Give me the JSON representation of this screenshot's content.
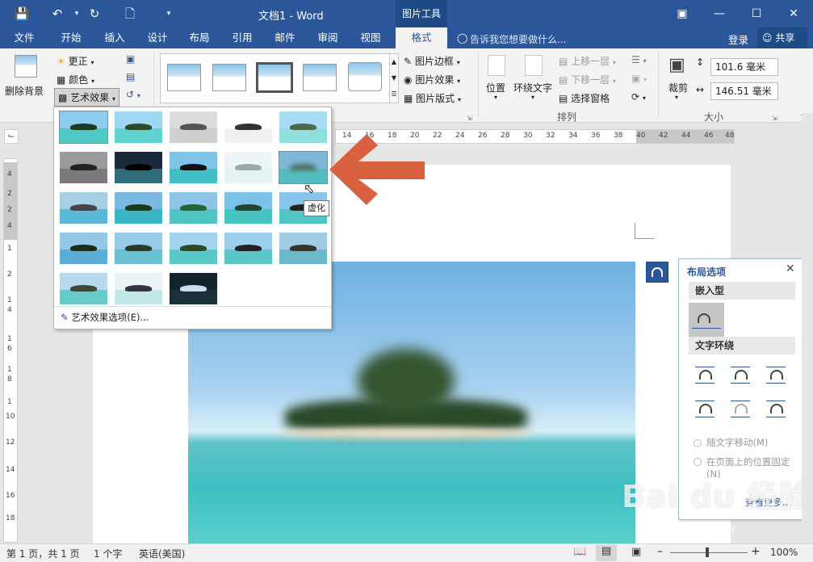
{
  "title": {
    "doc_title": "文档1 - Word",
    "context_tab_group": "图片工具"
  },
  "icons": {
    "save": "save-icon",
    "undo": "undo-icon",
    "redo": "redo-icon",
    "new": "new-doc-icon",
    "customize": "customize-qat-icon"
  },
  "tabs": [
    {
      "label": "文件"
    },
    {
      "label": "开始"
    },
    {
      "label": "插入"
    },
    {
      "label": "设计"
    },
    {
      "label": "布局"
    },
    {
      "label": "引用"
    },
    {
      "label": "邮件"
    },
    {
      "label": "审阅"
    },
    {
      "label": "视图"
    },
    {
      "label": "格式"
    }
  ],
  "tell_me": "告诉我您想要做什么...",
  "sign_in": "登录",
  "share": "共享",
  "ribbon": {
    "remove_bg": "删除背景",
    "corrections": "更正",
    "color": "颜色",
    "artistic": "艺术效果",
    "picture_border": "图片边框",
    "picture_effects": "图片效果",
    "picture_layout": "图片版式",
    "position": "位置",
    "wrap_text": "环绕文字",
    "bring_forward": "上移一层",
    "send_backward": "下移一层",
    "selection_pane": "选择窗格",
    "arrange_group": "排列",
    "crop": "裁剪",
    "height": "101.6 毫米",
    "width": "146.51 毫米",
    "size_group": "大小"
  },
  "ruler_numbers": [
    "14",
    "16",
    "18",
    "20",
    "22",
    "24",
    "26",
    "28",
    "30",
    "32",
    "34",
    "36",
    "38",
    "40",
    "42",
    "44",
    "46",
    "48"
  ],
  "vruler_numbers": [
    "4",
    "2",
    "2",
    "4",
    "1",
    "2",
    "1",
    "4",
    "1",
    "6",
    "1",
    "8",
    "1",
    "10",
    "12",
    "14",
    "16",
    "18",
    "2",
    "18"
  ],
  "gallery": {
    "tooltip": "虚化",
    "options_link": "艺术效果选项(E)..."
  },
  "layout_panel": {
    "title": "布局选项",
    "inline_section": "嵌入型",
    "wrap_section": "文字环绕",
    "move_with_text": "随文字移动(M)",
    "fix_position": "在页面上的位置固定(N)",
    "see_more": "查看更多..."
  },
  "status": {
    "page": "第 1 页，共 1 页",
    "words": "1 个字",
    "lang": "英语(美国)",
    "zoom": "100%"
  },
  "watermark": {
    "main": "Bai du 经验",
    "sub": "jingyan.baidu.com"
  }
}
